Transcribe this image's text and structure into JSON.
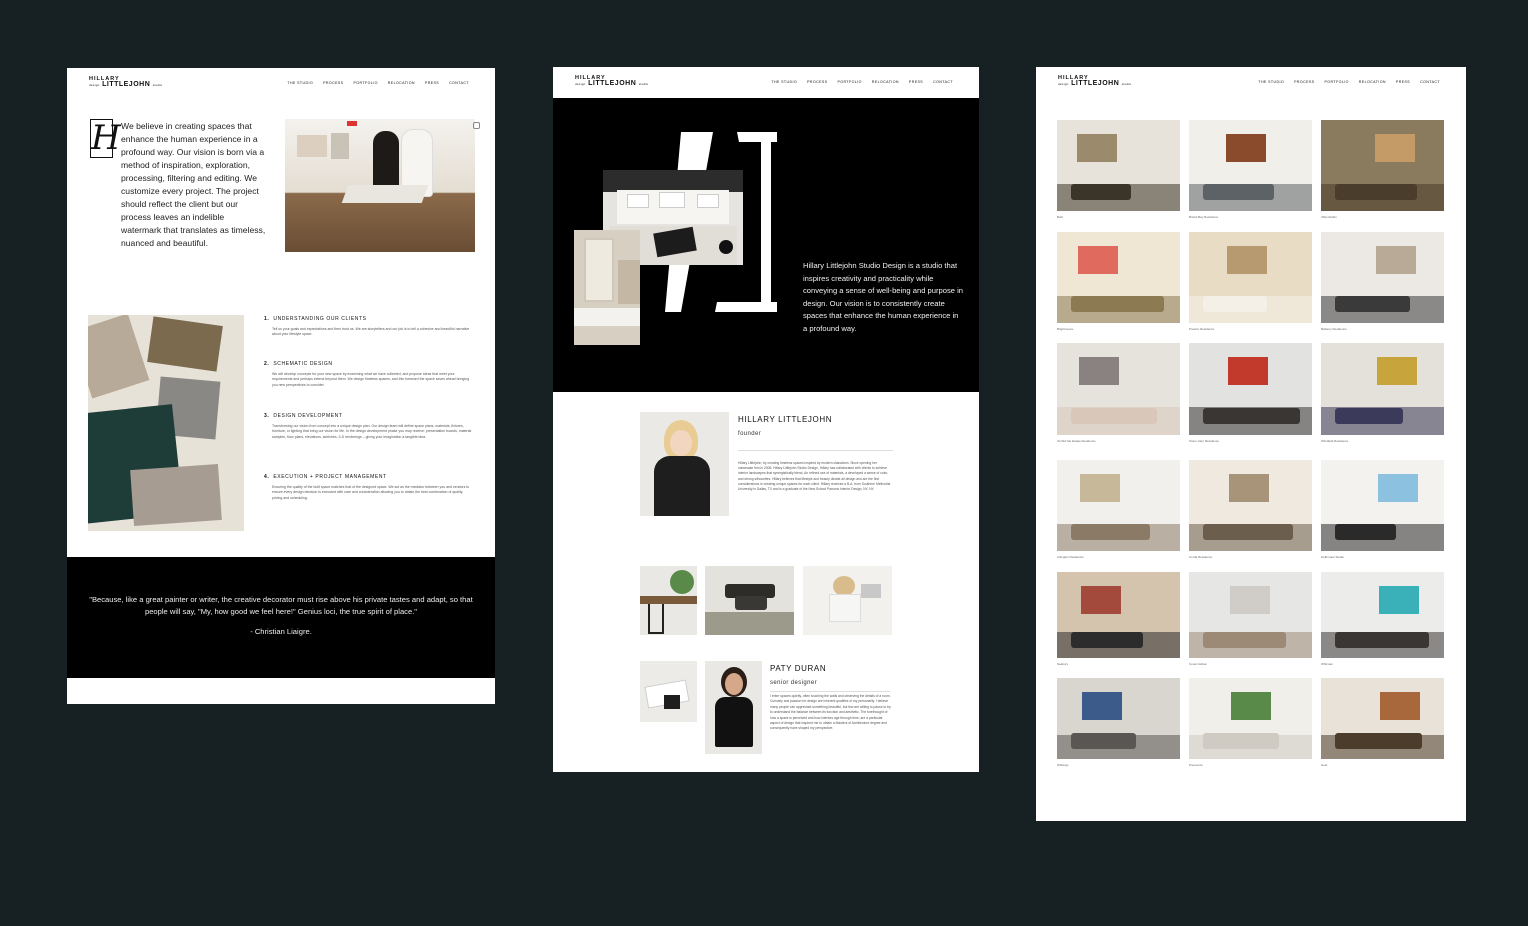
{
  "logo": {
    "line1": "HILLARY",
    "line2": "LITTLEJOHN",
    "tag1": "studio",
    "tag2": "design"
  },
  "nav": [
    "THE STUDIO",
    "PROCESS",
    "PORTFOLIO",
    "RELOCATION",
    "PRESS",
    "CONTACT"
  ],
  "studio": {
    "big_letter": "H",
    "intro": "We believe in creating spaces that enhance the human experience in a profound way.  Our vision is born via a method of inspiration, exploration, processing, filtering and editing.  We customize every project.  The project should reflect the client but our process leaves an indelible watermark that translates as timeless, nuanced and beautiful.",
    "steps": [
      {
        "num": "1.",
        "title": "UNDERSTANDING OUR CLIENTS",
        "body": "Tell us your goals and expectations and then trust us. We are storytellers and our job is to tell a cohesive and beautiful narrative about your lifestyle space."
      },
      {
        "num": "2.",
        "title": "SCHEMATIC DESIGN",
        "body": "We will develop concepts for your new space by examining what we have collected, and propose ideas that meet your requirements and perhaps extend beyond them. We design timeless spaces, and this foreword the space saves ahead bringing you new perspectives to consider."
      },
      {
        "num": "3.",
        "title": "DESIGN DEVELOPMENT",
        "body": "Transforming our vision from concept into a unique design plan. Our design team will define space plans, materials, fixtures, furniture, or lighting that bring our vision for life. In the design development phase you may receive: presentation boards, material samples, floor plans, elevations, sketches, 3-D renderings – giving your imagination a tangible idea."
      },
      {
        "num": "4.",
        "title": "EXECUTION + PROJECT MANAGEMENT",
        "body": "Ensuring the quality of the built space matches that of the designed space.  We act as the mediator between you and vendors to ensure every design decision is executed with care and consideration allowing you to obtain the best combination of quality, pricing and scheduling."
      }
    ],
    "quote": "\"Because, like a great painter or writer, the creative decorator must rise above his private tastes and adapt, so that people will say, \"My, how good we feel here!\" Genius loci, the true spirit of place.\"",
    "quote_author": "- Christian Liaigre."
  },
  "about": {
    "intro": "Hillary Littlejohn Studio Design is a studio that inspires creativity and practicality while conveying a sense of well-being and purpose in design. Our vision is to consistently create spaces that enhance the human experience in a profound way.",
    "founder_name": "HILLARY LITTLEJOHN",
    "founder_role": "founder",
    "founder_bio": "Hillary Littlejohn, by creating timeless spaces inspired by modern classicism. Since opening her namesake firm in 2008, Hillary Littlejohn Studio Design, Hillary has collaborated with clients to achieve interior landscapes that synergistically blend. An refined use of materials, a developed a sense of color, and strong silhouettes. Hillary believes that lifestyle and beauty dictate all design and are the first considerations in creating unique spaces for each client. Hillary received a B.A. from Southern Methodist University in Dallas, TX and is a graduate of the New School Parsons Interior Design, NY, NY.",
    "designer_name": "PATY DURAN",
    "designer_role": "senior designer",
    "designer_bio": "I enter spaces quietly, often touching the walls and observing the details of a room.  Curiosity and passion for design are inherent qualities of my personality.  I believe many people can appreciate something beautiful, but few are willing to pause to try to understand the balance between its function and aesthetic.  The forethought of how a space is perceived and how interiors age through time, are a particular aspect of design that inspired me to obtain a Masters of Architecture degree and consequently have shaped my perspective."
  },
  "portfolio": [
    {
      "caption": "Burk",
      "colors": [
        "#e8e3da",
        "#9c8a6c",
        "#3b3428"
      ]
    },
    {
      "caption": "Bristol Bay Residence",
      "colors": [
        "#f1efea",
        "#8a4a2c",
        "#5c6266"
      ]
    },
    {
      "caption": "Villa Clarkin",
      "colors": [
        "#8a7a5e",
        "#c49a66",
        "#4a3d2c"
      ]
    },
    {
      "caption": "Brightmoore",
      "colors": [
        "#efe6d4",
        "#e16a5e",
        "#8b7a52"
      ]
    },
    {
      "caption": "Preston Residence",
      "colors": [
        "#e8dcc4",
        "#b89a70",
        "#f4f0e8"
      ]
    },
    {
      "caption": "Bellamy Residence",
      "colors": [
        "#ece9e4",
        "#b8aa96",
        "#3a3a3a"
      ]
    },
    {
      "caption": "Orchid Isle Estate Residence",
      "colors": [
        "#e6e2dc",
        "#8a8280",
        "#d9c8ba"
      ]
    },
    {
      "caption": "Stone Glen Residence",
      "colors": [
        "#e2e2e0",
        "#c23a2c",
        "#3a3634"
      ]
    },
    {
      "caption": "Windfield Residence",
      "colors": [
        "#e4e0da",
        "#c8a43c",
        "#3c3a5a"
      ]
    },
    {
      "caption": "Arlington Residence",
      "colors": [
        "#f1f0ec",
        "#c8b89a",
        "#8a7a66"
      ]
    },
    {
      "caption": "Corda Residence",
      "colors": [
        "#efe9df",
        "#a89478",
        "#6c5e4c"
      ]
    },
    {
      "caption": "Holbrooke Studio",
      "colors": [
        "#f3f2ee",
        "#8cc2e0",
        "#2a2a2a"
      ]
    },
    {
      "caption": "Seabury",
      "colors": [
        "#d4c4ae",
        "#a34a3c",
        "#2c2c2c"
      ]
    },
    {
      "caption": "Conel Hollow",
      "colors": [
        "#e6e6e4",
        "#d0cdc8",
        "#9c8a76"
      ]
    },
    {
      "caption": "Whitman",
      "colors": [
        "#ecedea",
        "#3ab0b8",
        "#3a3634"
      ]
    },
    {
      "caption": "Whitings",
      "colors": [
        "#d9d6cf",
        "#3c5a8a",
        "#5a5654"
      ]
    },
    {
      "caption": "Preccente",
      "colors": [
        "#f0efea",
        "#5a8a4a",
        "#cfcac2"
      ]
    },
    {
      "caption": "Huet",
      "colors": [
        "#e8e2d8",
        "#a8683c",
        "#4c3c2c"
      ]
    }
  ]
}
